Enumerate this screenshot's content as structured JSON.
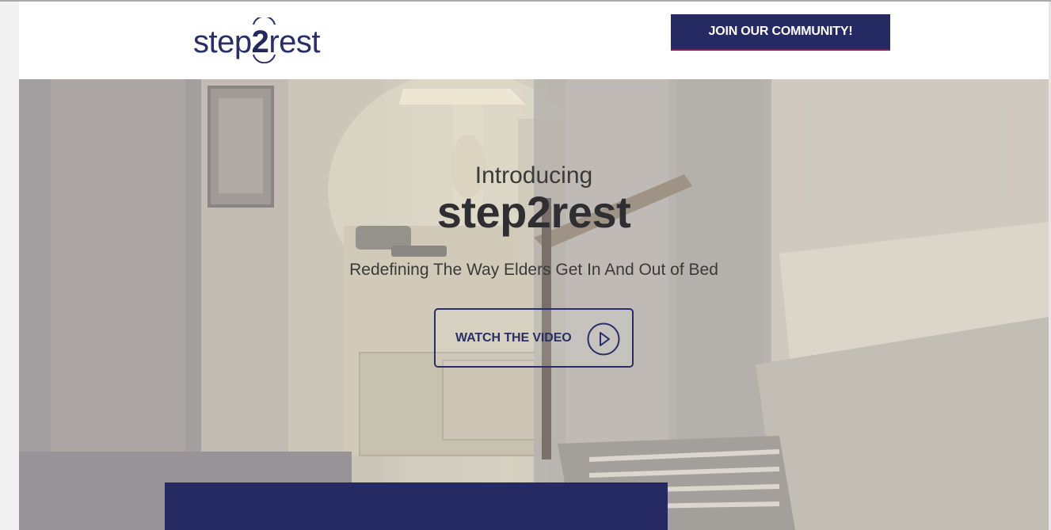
{
  "header": {
    "logo_text_start": "step",
    "logo_text_digit": "2",
    "logo_text_end": "rest",
    "join_button_label": "JOIN OUR COMMUNITY!"
  },
  "hero": {
    "intro": "Introducing",
    "title": "step2rest",
    "tagline": "Redefining The Way Elders Get In And Out of Bed",
    "watch_button_label": "WATCH THE VIDEO",
    "watch_button_icon": "play-circle-icon"
  },
  "colors": {
    "brand_navy": "#262a63",
    "header_bg": "#ffffff",
    "title_text": "#2f2f33"
  }
}
